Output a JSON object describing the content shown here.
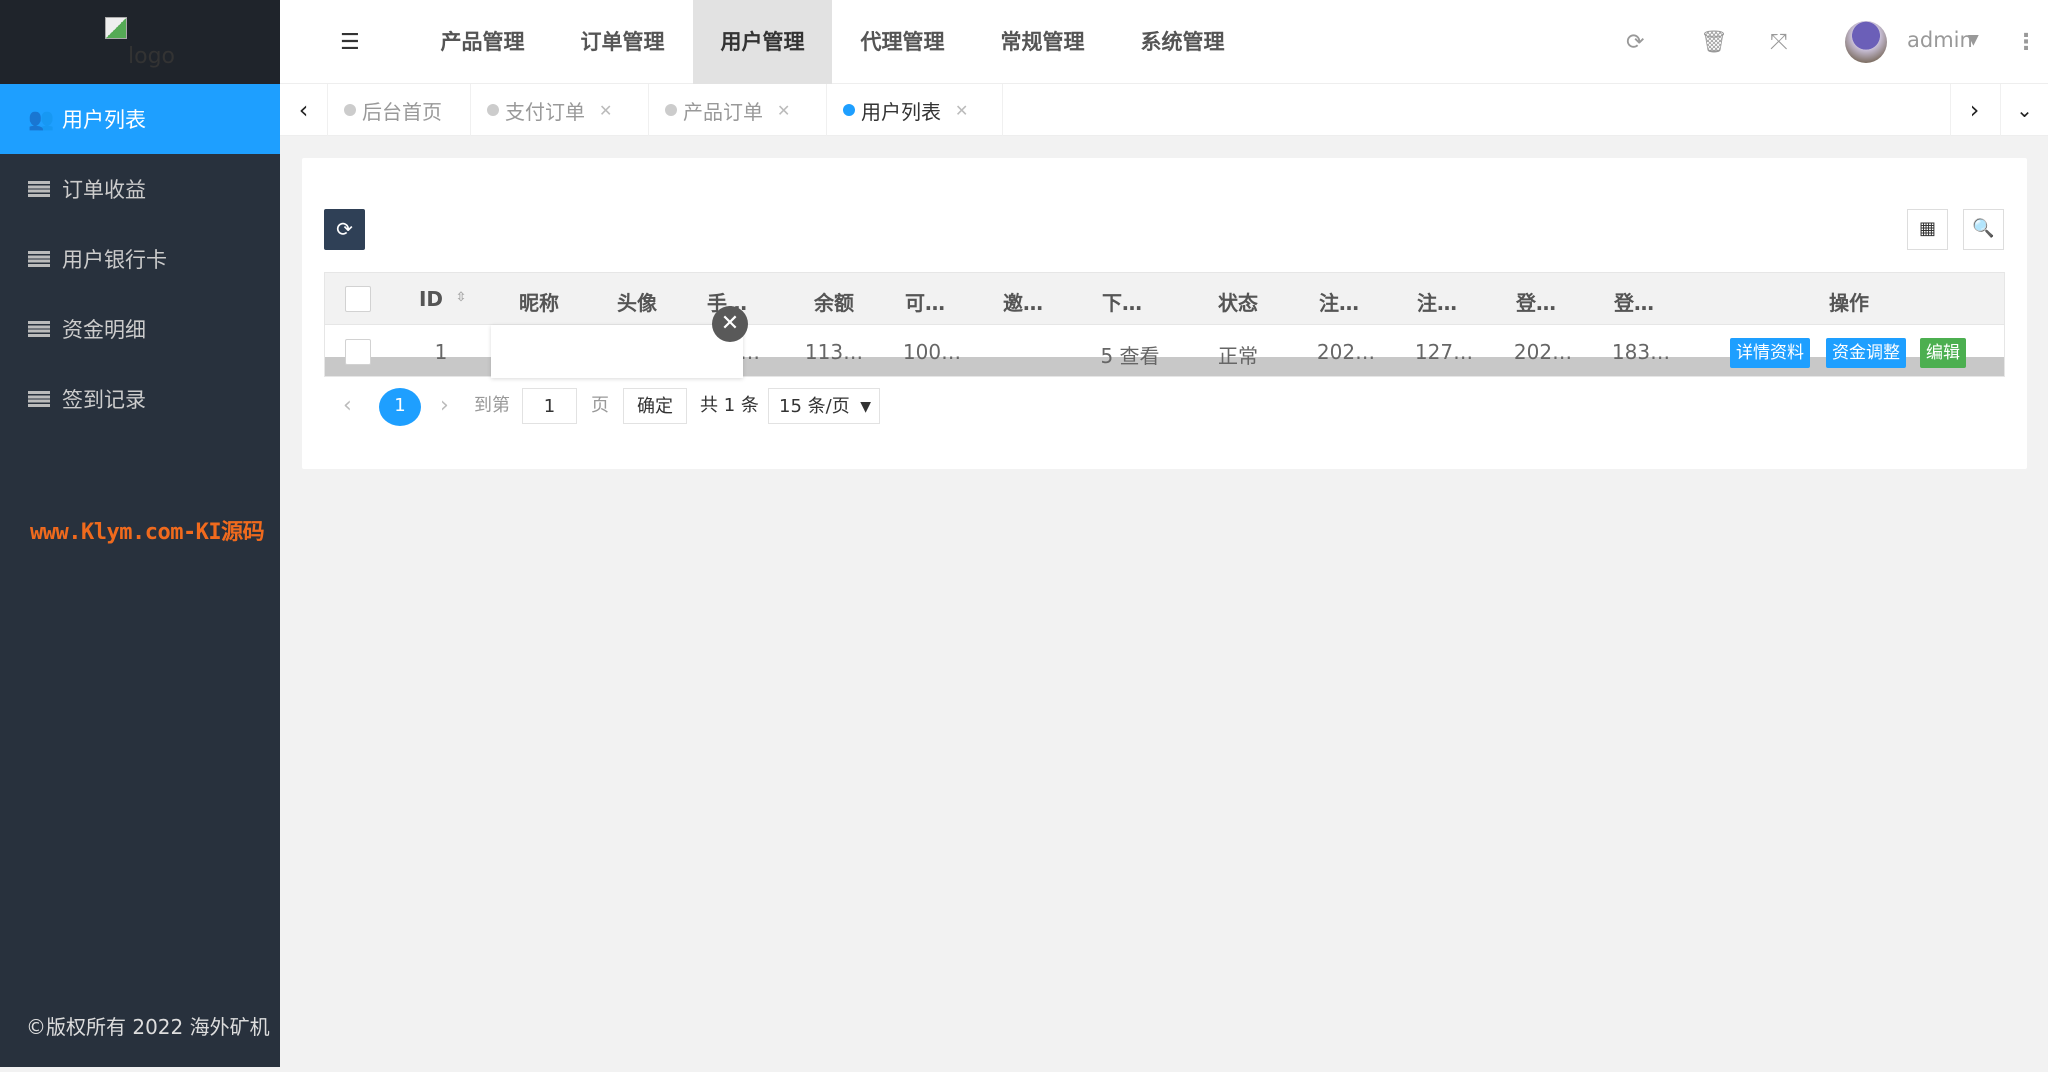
{
  "sidebar": {
    "logo_alt": "logo",
    "items": [
      {
        "label": "用户列表",
        "icon": "users-icon"
      },
      {
        "label": "订单收益",
        "icon": "list-icon"
      },
      {
        "label": "用户银行卡",
        "icon": "list-icon"
      },
      {
        "label": "资金明细",
        "icon": "list-icon"
      },
      {
        "label": "签到记录",
        "icon": "list-icon"
      }
    ],
    "watermark": "www.Klym.com-KI源码",
    "copyright": "©版权所有 2022 海外矿机"
  },
  "topnav": {
    "items": [
      "产品管理",
      "订单管理",
      "用户管理",
      "代理管理",
      "常规管理",
      "系统管理"
    ],
    "active": "用户管理",
    "user": "admin"
  },
  "tabs": [
    {
      "label": "后台首页"
    },
    {
      "label": "支付订单"
    },
    {
      "label": "产品订单"
    },
    {
      "label": "用户列表"
    }
  ],
  "table": {
    "headers": [
      "ID",
      "昵称",
      "头像",
      "手…",
      "余额",
      "可…",
      "邀…",
      "下…",
      "状态",
      "注…",
      "注…",
      "登…",
      "登…",
      "操作"
    ],
    "rows": [
      {
        "id": "1",
        "phone": "…",
        "balance": "113…",
        "available": "100…",
        "invite": "",
        "sub": "5 查看",
        "status": "正常",
        "reg_time": "202…",
        "reg_ip": "127…",
        "login_time": "202…",
        "login_ip": "183…"
      }
    ],
    "actions": [
      {
        "label": "详情资料",
        "color": "#1e9fff"
      },
      {
        "label": "资金调整",
        "color": "#1e9fff"
      },
      {
        "label": "编辑",
        "color": "#4caf50"
      }
    ]
  },
  "pagination": {
    "current": "1",
    "goto_label": "到第",
    "goto_value": "1",
    "page_label": "页",
    "confirm": "确定",
    "total": "共 1 条",
    "page_size": "15 条/页"
  },
  "colors": {
    "accent": "#1e9fff",
    "sidebar": "#28313d",
    "watermark": "#f06a1d"
  }
}
